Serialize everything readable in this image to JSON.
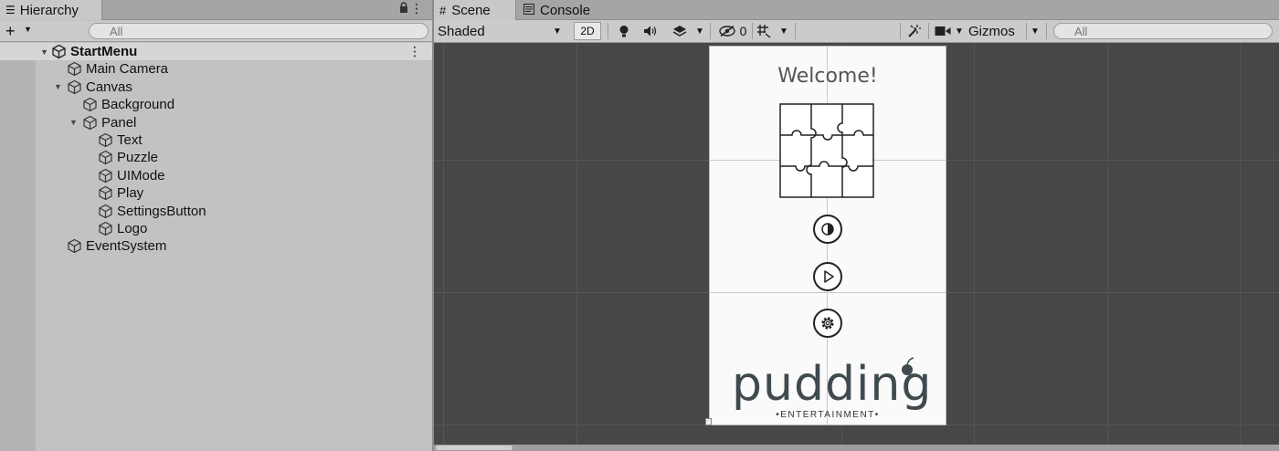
{
  "hierarchy": {
    "tab_title": "Hierarchy",
    "add_label": "+",
    "search_placeholder": "All",
    "items": [
      {
        "label": "StartMenu",
        "depth": 0,
        "expanded": true,
        "type": "scene"
      },
      {
        "label": "Main Camera",
        "depth": 1,
        "type": "gameobject"
      },
      {
        "label": "Canvas",
        "depth": 1,
        "expanded": true,
        "type": "gameobject"
      },
      {
        "label": "Background",
        "depth": 2,
        "type": "gameobject"
      },
      {
        "label": "Panel",
        "depth": 2,
        "expanded": true,
        "type": "gameobject"
      },
      {
        "label": "Text",
        "depth": 3,
        "type": "gameobject"
      },
      {
        "label": "Puzzle",
        "depth": 3,
        "type": "gameobject"
      },
      {
        "label": "UIMode",
        "depth": 3,
        "type": "gameobject"
      },
      {
        "label": "Play",
        "depth": 3,
        "type": "gameobject"
      },
      {
        "label": "SettingsButton",
        "depth": 3,
        "type": "gameobject"
      },
      {
        "label": "Logo",
        "depth": 3,
        "type": "gameobject"
      },
      {
        "label": "EventSystem",
        "depth": 1,
        "type": "gameobject"
      }
    ]
  },
  "scene_view": {
    "tabs": [
      {
        "label": "Scene",
        "icon": "grid-icon",
        "active": true
      },
      {
        "label": "Console",
        "icon": "console-icon",
        "active": false
      }
    ],
    "toolbar": {
      "shading_mode": "Shaded",
      "mode_2d_label": "2D",
      "hidden_count": "0",
      "gizmos_label": "Gizmos",
      "search_placeholder": "All"
    },
    "game": {
      "welcome_text": "Welcome!",
      "logo_text": "pudding",
      "logo_subtitle": "•ENTERTAINMENT•"
    }
  },
  "colors": {
    "panel_bg": "#c2c2c2",
    "tabbar_bg": "#a5a5a5",
    "viewport_bg": "#474747",
    "canvas_bg": "#fafafa"
  }
}
